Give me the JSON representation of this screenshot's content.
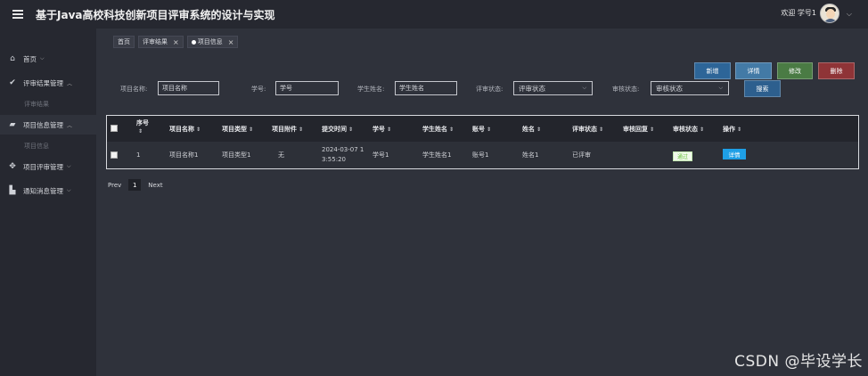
{
  "header": {
    "title": "基于Java高校科技创新项目评审系统的设计与实现",
    "welcome": "欢迎 学号1"
  },
  "sidebar": {
    "items": [
      {
        "label": "首页",
        "icon": "home-icon",
        "sub": null
      },
      {
        "label": "评审结果管理",
        "icon": "check-circle-icon",
        "sub": "评审结果"
      },
      {
        "label": "项目信息管理",
        "icon": "folder-icon",
        "sub": "项目信息"
      },
      {
        "label": "项目评审管理",
        "icon": "grid-icon",
        "sub": null
      },
      {
        "label": "通知消息管理",
        "icon": "building-icon",
        "sub": null
      }
    ]
  },
  "tabs": [
    {
      "label": "首页",
      "closable": false
    },
    {
      "label": "评审结果",
      "closable": true
    },
    {
      "label": "项目信息",
      "closable": true,
      "active": true
    }
  ],
  "actions": {
    "add": "新增",
    "detail": "详情",
    "edit": "修改",
    "delete": "删除",
    "search": "搜索"
  },
  "search": {
    "project_name": {
      "label": "项目名称:",
      "placeholder": "项目名称"
    },
    "student_no": {
      "label": "学号:",
      "placeholder": "学号"
    },
    "student_name": {
      "label": "学生姓名:",
      "placeholder": "学生姓名"
    },
    "review_status": {
      "label": "评审状态:",
      "placeholder": "评审状态"
    },
    "audit_status": {
      "label": "审核状态:",
      "placeholder": "审核状态"
    }
  },
  "table": {
    "headers": [
      "序号",
      "项目名称",
      "项目类型",
      "项目附件",
      "提交时间",
      "学号",
      "学生姓名",
      "账号",
      "姓名",
      "评审状态",
      "审核回复",
      "审核状态",
      "操作"
    ],
    "rows": [
      {
        "index": "1",
        "project_name": "项目名称1",
        "project_type": "项目类型1",
        "attachment": "无",
        "submit_time_line1": "2024-03-07 1",
        "submit_time_line2": "3:55:20",
        "student_no": "学号1",
        "student_name": "学生姓名1",
        "account": "账号1",
        "name": "姓名1",
        "review_status": "已评审",
        "audit_reply": "",
        "audit_status": "通过",
        "action": "详情"
      }
    ]
  },
  "pager": {
    "prev": "Prev",
    "page": "1",
    "next": "Next"
  },
  "watermark": "CSDN @毕设学长",
  "colors": {
    "background": "#2f323b",
    "topbar": "#262830",
    "add": "#2d6598",
    "detail": "#437aa6",
    "edit": "#4a7b44",
    "delete": "#8f3437",
    "row_action": "#1e9fe6",
    "pass_badge_text": "#67c23a"
  }
}
